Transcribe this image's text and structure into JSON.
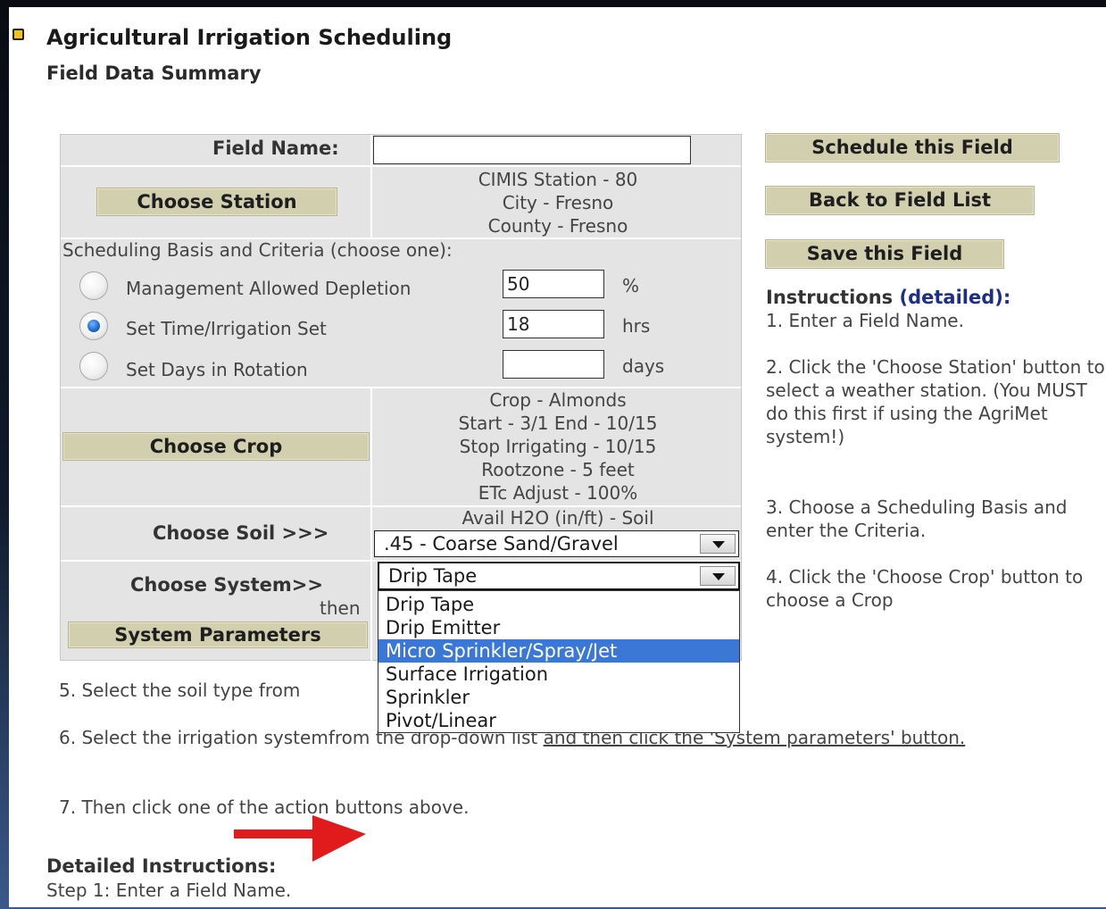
{
  "header": {
    "title": "Agricultural Irrigation Scheduling",
    "subtitle": "Field Data Summary"
  },
  "form": {
    "field_name_label": "Field Name:",
    "field_name_value": "",
    "choose_station_button": "Choose Station",
    "station_lines": [
      "CIMIS Station - 80",
      "City - Fresno",
      "County - Fresno"
    ],
    "criteria_label": "Scheduling Basis and Criteria (choose one):",
    "criteria": [
      {
        "label": "Management Allowed Depletion",
        "value": "50",
        "unit": "%",
        "checked": false
      },
      {
        "label": "Set Time/Irrigation Set",
        "value": "18",
        "unit": "hrs",
        "checked": true
      },
      {
        "label": "Set Days in Rotation",
        "value": "",
        "unit": "days",
        "checked": false
      }
    ],
    "choose_crop_button": "Choose Crop",
    "crop_lines": [
      "Crop - Almonds",
      "Start - 3/1 End - 10/15",
      "Stop Irrigating - 10/15",
      "Rootzone - 5 feet",
      "ETc Adjust - 100%"
    ],
    "soil_label": "Choose Soil >>>",
    "soil_caption": "Avail H2O (in/ft) - Soil",
    "soil_selected": ".45 - Coarse Sand/Gravel",
    "system_label": "Choose System>>",
    "then_label": "then",
    "system_selected": "Drip Tape",
    "system_options": [
      "Drip Tape",
      "Drip Emitter",
      "Micro Sprinkler/Spray/Jet",
      "Surface Irrigation",
      "Sprinkler",
      "Pivot/Linear"
    ],
    "system_highlighted_index": 2,
    "system_parameters_button": "System Parameters"
  },
  "actions": {
    "schedule": "Schedule this Field",
    "back": "Back to Field List",
    "save": "Save this Field"
  },
  "instructions": {
    "heading": "Instructions",
    "detailed_link": "(detailed):",
    "step1": "1. Enter a Field Name.",
    "step2": "2. Click the 'Choose Station' button to select a weather station. (You MUST do this first if using the AgriMet system!)",
    "step3": "3. Choose a Scheduling Basis and enter the Criteria.",
    "step4": "4. Click the 'Choose Crop' button to choose a Crop"
  },
  "bottom": {
    "step5": "5. Select the soil type from",
    "step6_plain": "6. Select the irrigation system",
    "step6_hidden": "from the drop-down list",
    "step6_link": "and then click the 'System parameters' button.",
    "step7": "7. Then click one of the action buttons above.",
    "detailed_heading": "Detailed Instructions:",
    "detailed_step1": "Step 1: Enter a Field Name."
  },
  "colors": {
    "button_bg": "#d2cfae",
    "table_bg": "#e4e4e4",
    "highlight": "#3b78d6",
    "link": "#1d2e8a",
    "arrow": "#e11b1b"
  },
  "icons": [
    "bullet-icon",
    "radio-icon",
    "dropdown-arrow-icon",
    "red-arrow-icon"
  ]
}
